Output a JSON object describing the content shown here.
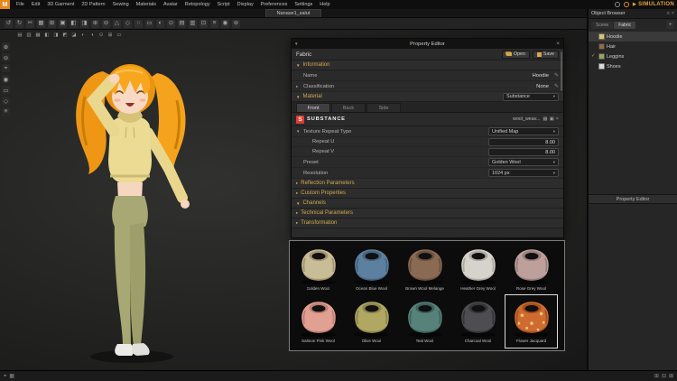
{
  "app": {
    "logo_letter": "M",
    "window_tab_title": "Nanase1_salut",
    "simulation_label": "SIMULATION"
  },
  "icons": {
    "caret_down": "▼",
    "caret_right": "▸",
    "caret_down_small": "▾",
    "dropdown_caret": "▾",
    "close": "×",
    "check": "✓",
    "edit": "✎",
    "menu": "≡",
    "play": "▶"
  },
  "menu": {
    "items": [
      "File",
      "Edit",
      "3D Garment",
      "2D Pattern",
      "Sewing",
      "Materials",
      "Avatar",
      "Retopology",
      "Script",
      "Display",
      "Preferences",
      "Settings",
      "Help"
    ]
  },
  "toolbar": {
    "icons": [
      "↺",
      "↻",
      "✂",
      "▦",
      "⊞",
      "▣",
      "◧",
      "◨",
      "⊕",
      "⊖",
      "△",
      "◇",
      "○",
      "▭",
      "◐",
      "⊙",
      "▤",
      "▥",
      "⊡",
      "≡",
      "◉",
      "⊚"
    ]
  },
  "view_toolbar": {
    "icons": [
      "▤",
      "▥",
      "▦",
      "◧",
      "◨",
      "◩",
      "◪",
      "◐",
      "◑",
      "⊙",
      "⊞",
      "▭"
    ]
  },
  "side_toolbar": {
    "icons": [
      "⊕",
      "⊖",
      "⌖",
      "◉",
      "▭",
      "◇",
      "≡"
    ]
  },
  "property_editor": {
    "title": "Property Editor",
    "fabric_label": "Fabric",
    "open_button": "Open",
    "save_button": "Save",
    "information_section": "Information",
    "name_label": "Name",
    "name_value": "Hoodie",
    "classification_label": "Classification",
    "classification_value": "None",
    "material_section": "Material",
    "material_type": "Substance",
    "tabs": [
      {
        "label": "Front",
        "active": true
      },
      {
        "label": "Back",
        "active": false
      },
      {
        "label": "Side",
        "active": false
      }
    ],
    "substance_logo_letter": "S",
    "substance_brand": "SUBSTANCE",
    "substance_file": "wool_weav...",
    "substance_icons": [
      "▦",
      "▣",
      "×"
    ],
    "texture_repeat_label": "Texture Repeat Type",
    "texture_repeat_value": "Unified Map",
    "repeat_u_label": "Repeat U",
    "repeat_u_value": "8.00",
    "repeat_v_label": "Repeat V",
    "repeat_v_value": "8.00",
    "preset_label": "Preset",
    "preset_value": "Golden Wool",
    "resolution_label": "Resolution",
    "resolution_value": "1024 px",
    "reflection_section": "Reflection Parameters",
    "custom_properties_section": "Custom Properties",
    "channels_section": "Channels",
    "technical_section": "Technical Parameters",
    "transformation_section": "Transformation"
  },
  "materials_gallery": {
    "items": [
      {
        "name": "Golden Wool",
        "body": "#c9bd97",
        "shade": "#a39570",
        "selected": false,
        "floral": false
      },
      {
        "name": "Ocean Blue Wool",
        "body": "#5d80a0",
        "shade": "#46667f",
        "selected": false,
        "floral": false
      },
      {
        "name": "Brown Wool Melange",
        "body": "#8a6a52",
        "shade": "#6d523f",
        "selected": false,
        "floral": false
      },
      {
        "name": "Heather Grey Wool",
        "body": "#d6d3cc",
        "shade": "#aeaba2",
        "selected": false,
        "floral": false
      },
      {
        "name": "Rose Grey Wool",
        "body": "#bda09b",
        "shade": "#99807c",
        "selected": false,
        "floral": false
      },
      {
        "name": "Salmon Pink Wool",
        "body": "#e2a093",
        "shade": "#bd8075",
        "selected": false,
        "floral": false
      },
      {
        "name": "Olive Wool",
        "body": "#b0a763",
        "shade": "#8d854c",
        "selected": false,
        "floral": false
      },
      {
        "name": "Teal Wool",
        "body": "#57827a",
        "shade": "#40645d",
        "selected": false,
        "floral": false
      },
      {
        "name": "Charcoal Wool",
        "body": "#4d4d52",
        "shade": "#36363a",
        "selected": false,
        "floral": false
      },
      {
        "name": "Flower Jacquard",
        "body": "#cf6b30",
        "shade": "#a84f1e",
        "selected": true,
        "floral": true
      }
    ]
  },
  "object_browser": {
    "title": "Object Browser",
    "header_icons": [
      "≡",
      "×"
    ],
    "tabs": [
      {
        "label": "Scene",
        "active": false
      },
      {
        "label": "Fabric",
        "active": true
      }
    ],
    "add_button": "+",
    "items": [
      {
        "name": "Hoodie",
        "swatch": "#d6c083",
        "checked": false,
        "selected": true
      },
      {
        "name": "Hair",
        "swatch": "#8d6b4f",
        "checked": false,
        "selected": false
      },
      {
        "name": "Leggins",
        "swatch": "#9aa06b",
        "checked": true,
        "selected": false
      },
      {
        "name": "Shoes",
        "swatch": "#d9d9d9",
        "checked": false,
        "selected": false
      }
    ],
    "collapsed_panel_title": "Property Editor"
  },
  "status_bar": {
    "left_icons": [
      "⌖",
      "▦"
    ],
    "right_icons": [
      "⊞",
      "⊟",
      "⊠"
    ]
  }
}
